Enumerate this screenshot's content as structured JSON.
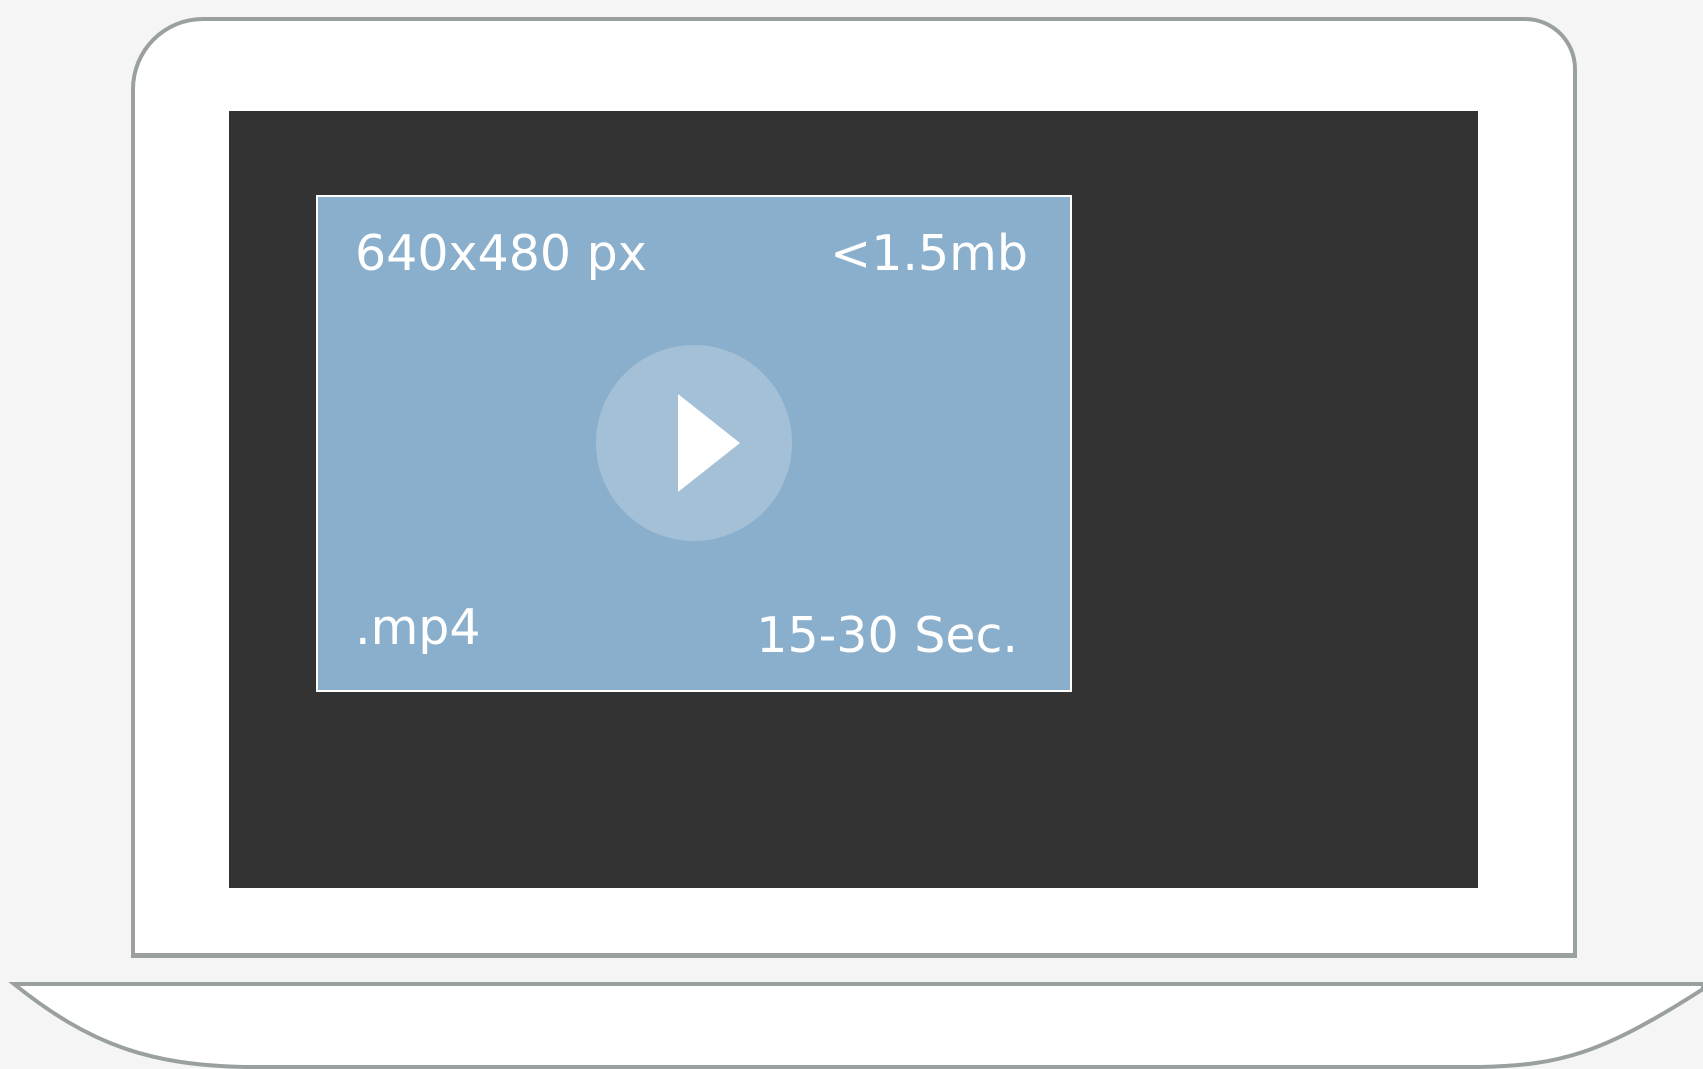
{
  "video": {
    "resolution": "640x480 px",
    "file_size": "<1.5mb",
    "format": ".mp4",
    "duration": "15-30 Sec."
  },
  "icons": {
    "play": "play-icon"
  },
  "colors": {
    "background": "#f5f5f5",
    "laptop_body": "#ffffff",
    "laptop_outline": "#9aa0a0",
    "screen": "#333333",
    "video_card": "#8aafcc",
    "text": "#ffffff"
  }
}
